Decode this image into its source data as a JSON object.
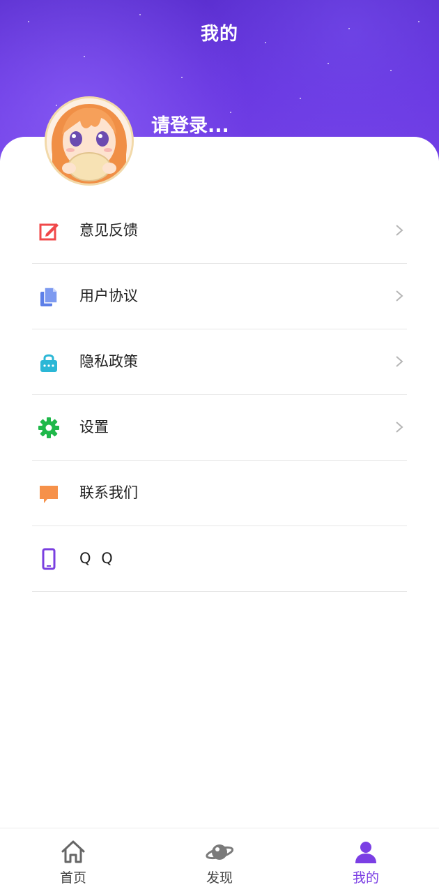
{
  "header": {
    "title": "我的",
    "bg_color": "#6535dc"
  },
  "profile": {
    "avatar": "anime-girl-avatar",
    "login_prompt": "请登录..."
  },
  "menu": {
    "items": [
      {
        "label": "意见反馈",
        "icon": "edit-icon",
        "color": "#f0484a",
        "has_arrow": true
      },
      {
        "label": "用户协议",
        "icon": "document-icon",
        "color": "#5c7fe8",
        "has_arrow": true
      },
      {
        "label": "隐私政策",
        "icon": "lock-icon",
        "color": "#2bb7d6",
        "has_arrow": true
      },
      {
        "label": "设置",
        "icon": "gear-icon",
        "color": "#1fb84a",
        "has_arrow": true
      },
      {
        "label": "联系我们",
        "icon": "chat-icon",
        "color": "#f6914a",
        "has_arrow": false
      },
      {
        "label": "Q Q",
        "icon": "phone-icon",
        "color": "#7a3fe0",
        "has_arrow": false
      }
    ]
  },
  "tabbar": {
    "tabs": [
      {
        "label": "首页",
        "icon": "home-icon",
        "active": false
      },
      {
        "label": "发现",
        "icon": "planet-icon",
        "active": false
      },
      {
        "label": "我的",
        "icon": "user-icon",
        "active": true
      }
    ],
    "active_color": "#7b3fe4"
  }
}
